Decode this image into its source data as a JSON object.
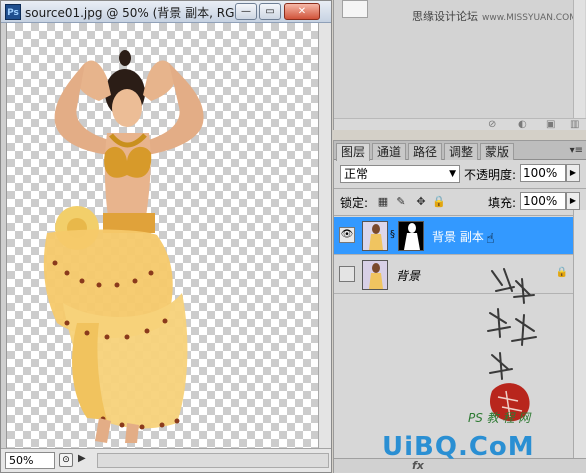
{
  "document": {
    "title": "source01.jpg @ 50% (背景 副本, RG...",
    "app_icon": "Ps",
    "zoom": "50%",
    "window_buttons": {
      "minimize": "—",
      "restore": "▭",
      "close": "✕"
    }
  },
  "top_panel": {
    "watermark": "思缘设计论坛",
    "watermark_site": "www.MISSYUAN.COM"
  },
  "layers_panel": {
    "tabs": [
      {
        "label": "图层",
        "active": true
      },
      {
        "label": "通道",
        "active": false
      },
      {
        "label": "路径",
        "active": false
      },
      {
        "label": "调整",
        "active": false
      },
      {
        "label": "蒙版",
        "active": false
      }
    ],
    "blend_mode": "正常",
    "opacity_label": "不透明度:",
    "opacity_value": "100%",
    "lock_label": "锁定:",
    "fill_label": "填充:",
    "fill_value": "100%",
    "layers": [
      {
        "name": "背景 副本",
        "visible": true,
        "selected": true,
        "has_mask": true,
        "locked": false
      },
      {
        "name": "背景",
        "visible": false,
        "selected": false,
        "has_mask": false,
        "locked": true
      }
    ],
    "footer_fx": "fx"
  },
  "overlay": {
    "ps_signature": "PS 教 程 网",
    "site_logo": "UiBQ.CoM",
    "site_logo_sub": "UiBQ.CoM"
  },
  "colors": {
    "selection_blue": "#3399ff",
    "panel_gray": "#d7d7d7",
    "logo_blue": "#2a8fd3"
  }
}
